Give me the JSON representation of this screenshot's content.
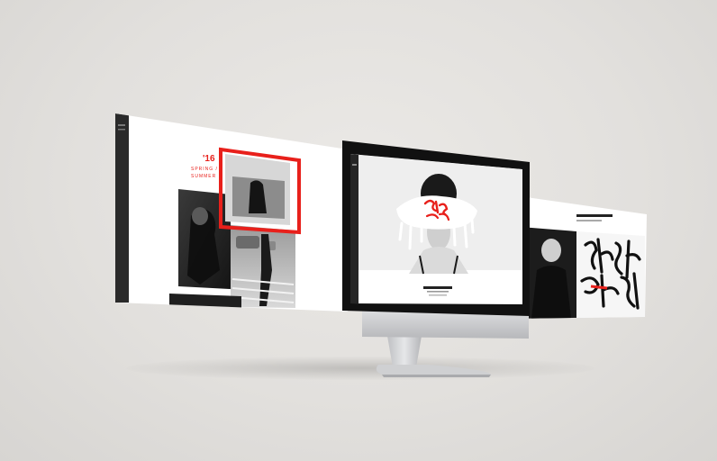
{
  "left_panel": {
    "year": "'16",
    "headline_line1": "SPRING /",
    "headline_line2": "SUMMER",
    "accent_color": "#e8201b"
  },
  "center_screen": {
    "hero_caption_line1": "",
    "hero_caption_line2": ""
  },
  "right_panel": {
    "header_line1": "",
    "header_line2": ""
  },
  "colors": {
    "background": "#e4e2df",
    "screen_bezel": "#111111",
    "aluminum": "#c9cacc",
    "accent": "#e8201b",
    "sidebar_dark": "#2a2a2a"
  }
}
